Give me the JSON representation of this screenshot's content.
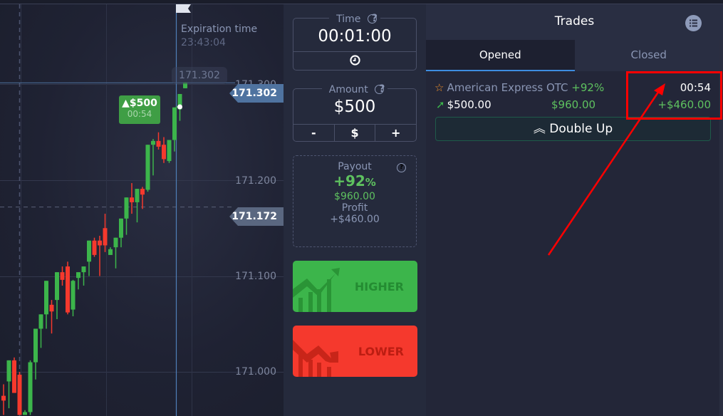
{
  "chart": {
    "expiration_label": "Expiration time",
    "expiration_time": "23:43:04",
    "hover_price": "171.302",
    "current_price_tag": "171.302",
    "reference_price_tag": "171.172",
    "trade_badge": {
      "amount": "$500",
      "countdown": "00:54",
      "direction": "up"
    },
    "colors": {
      "up": "#3cb54b",
      "down": "#f5392d",
      "grid": "#3a3f55",
      "crosshair": "#4f73a0"
    }
  },
  "chart_data": {
    "type": "candlestick",
    "title": "",
    "xlabel": "",
    "ylabel": "",
    "y_ticks": [
      "171.300",
      "171.200",
      "171.100",
      "171.000"
    ],
    "ylim": [
      170.955,
      171.388
    ],
    "current_price": 171.302,
    "reference_price": 171.172,
    "candles": [
      {
        "o": 170.975,
        "h": 170.987,
        "l": 170.955,
        "c": 170.97
      },
      {
        "o": 170.99,
        "h": 171.005,
        "l": 170.962,
        "c": 171.012
      },
      {
        "o": 171.012,
        "h": 171.015,
        "l": 170.985,
        "c": 170.978
      },
      {
        "o": 170.997,
        "h": 171.0,
        "l": 170.955,
        "c": 170.955
      },
      {
        "o": 170.955,
        "h": 170.96,
        "l": 170.955,
        "c": 170.958
      },
      {
        "o": 170.958,
        "h": 171.012,
        "l": 170.955,
        "c": 171.01
      },
      {
        "o": 171.01,
        "h": 171.04,
        "l": 170.992,
        "c": 171.045
      },
      {
        "o": 171.045,
        "h": 171.055,
        "l": 171.025,
        "c": 171.06
      },
      {
        "o": 171.06,
        "h": 171.068,
        "l": 171.045,
        "c": 171.095
      },
      {
        "o": 171.07,
        "h": 171.075,
        "l": 171.04,
        "c": 171.063
      },
      {
        "o": 171.075,
        "h": 171.09,
        "l": 171.055,
        "c": 171.104
      },
      {
        "o": 171.104,
        "h": 171.11,
        "l": 171.09,
        "c": 171.096
      },
      {
        "o": 171.11,
        "h": 171.115,
        "l": 171.06,
        "c": 171.062
      },
      {
        "o": 171.065,
        "h": 171.096,
        "l": 171.058,
        "c": 171.095
      },
      {
        "o": 171.098,
        "h": 171.102,
        "l": 171.086,
        "c": 171.104
      },
      {
        "o": 171.104,
        "h": 171.108,
        "l": 171.09,
        "c": 171.11
      },
      {
        "o": 171.115,
        "h": 171.13,
        "l": 171.1,
        "c": 171.137
      },
      {
        "o": 171.137,
        "h": 171.14,
        "l": 171.12,
        "c": 171.122
      },
      {
        "o": 171.137,
        "h": 171.142,
        "l": 171.1,
        "c": 171.132
      },
      {
        "o": 171.15,
        "h": 171.165,
        "l": 171.125,
        "c": 171.132
      },
      {
        "o": 171.122,
        "h": 171.13,
        "l": 171.125,
        "c": 171.128
      },
      {
        "o": 171.13,
        "h": 171.137,
        "l": 171.108,
        "c": 171.14
      },
      {
        "o": 171.14,
        "h": 171.15,
        "l": 171.13,
        "c": 171.16
      },
      {
        "o": 171.16,
        "h": 171.167,
        "l": 171.143,
        "c": 171.182
      },
      {
        "o": 171.182,
        "h": 171.197,
        "l": 171.165,
        "c": 171.177
      },
      {
        "o": 171.177,
        "h": 171.186,
        "l": 171.156,
        "c": 171.191
      },
      {
        "o": 171.191,
        "h": 171.193,
        "l": 171.17,
        "c": 171.185
      },
      {
        "o": 171.19,
        "h": 171.195,
        "l": 171.188,
        "c": 171.237
      },
      {
        "o": 171.237,
        "h": 171.243,
        "l": 171.205,
        "c": 171.241
      },
      {
        "o": 171.241,
        "h": 171.25,
        "l": 171.232,
        "c": 171.235
      },
      {
        "o": 171.237,
        "h": 171.245,
        "l": 171.218,
        "c": 171.222
      },
      {
        "o": 171.22,
        "h": 171.242,
        "l": 171.218,
        "c": 171.242
      },
      {
        "o": 171.242,
        "h": 171.275,
        "l": 171.23,
        "c": 171.276
      },
      {
        "o": 171.274,
        "h": 171.29,
        "l": 171.262,
        "c": 171.29
      },
      {
        "o": 171.296,
        "h": 171.302,
        "l": 171.296,
        "c": 171.302
      }
    ]
  },
  "trade_panel": {
    "time": {
      "label": "Time",
      "value": "00:01:00"
    },
    "amount": {
      "label": "Amount",
      "value": "$500",
      "minus": "-",
      "currency": "$",
      "plus": "+"
    },
    "payout": {
      "label": "Payout",
      "percent": "+92",
      "percent_sign": "%",
      "total": "$960.00",
      "profit_label": "Profit",
      "profit": "+$460.00"
    },
    "higher_label": "HIGHER",
    "lower_label": "LOWER"
  },
  "trades": {
    "title": "Trades",
    "tabs": [
      {
        "label": "Opened",
        "active": true
      },
      {
        "label": "Closed",
        "active": false
      }
    ],
    "items": [
      {
        "asset": "American Express OTC",
        "payout_pct": "+92%",
        "amount": "$500.00",
        "payout": "$960.00",
        "time_left": "00:54",
        "profit": "+$460.00",
        "direction": "up"
      }
    ],
    "double_up_label": "Double Up"
  }
}
